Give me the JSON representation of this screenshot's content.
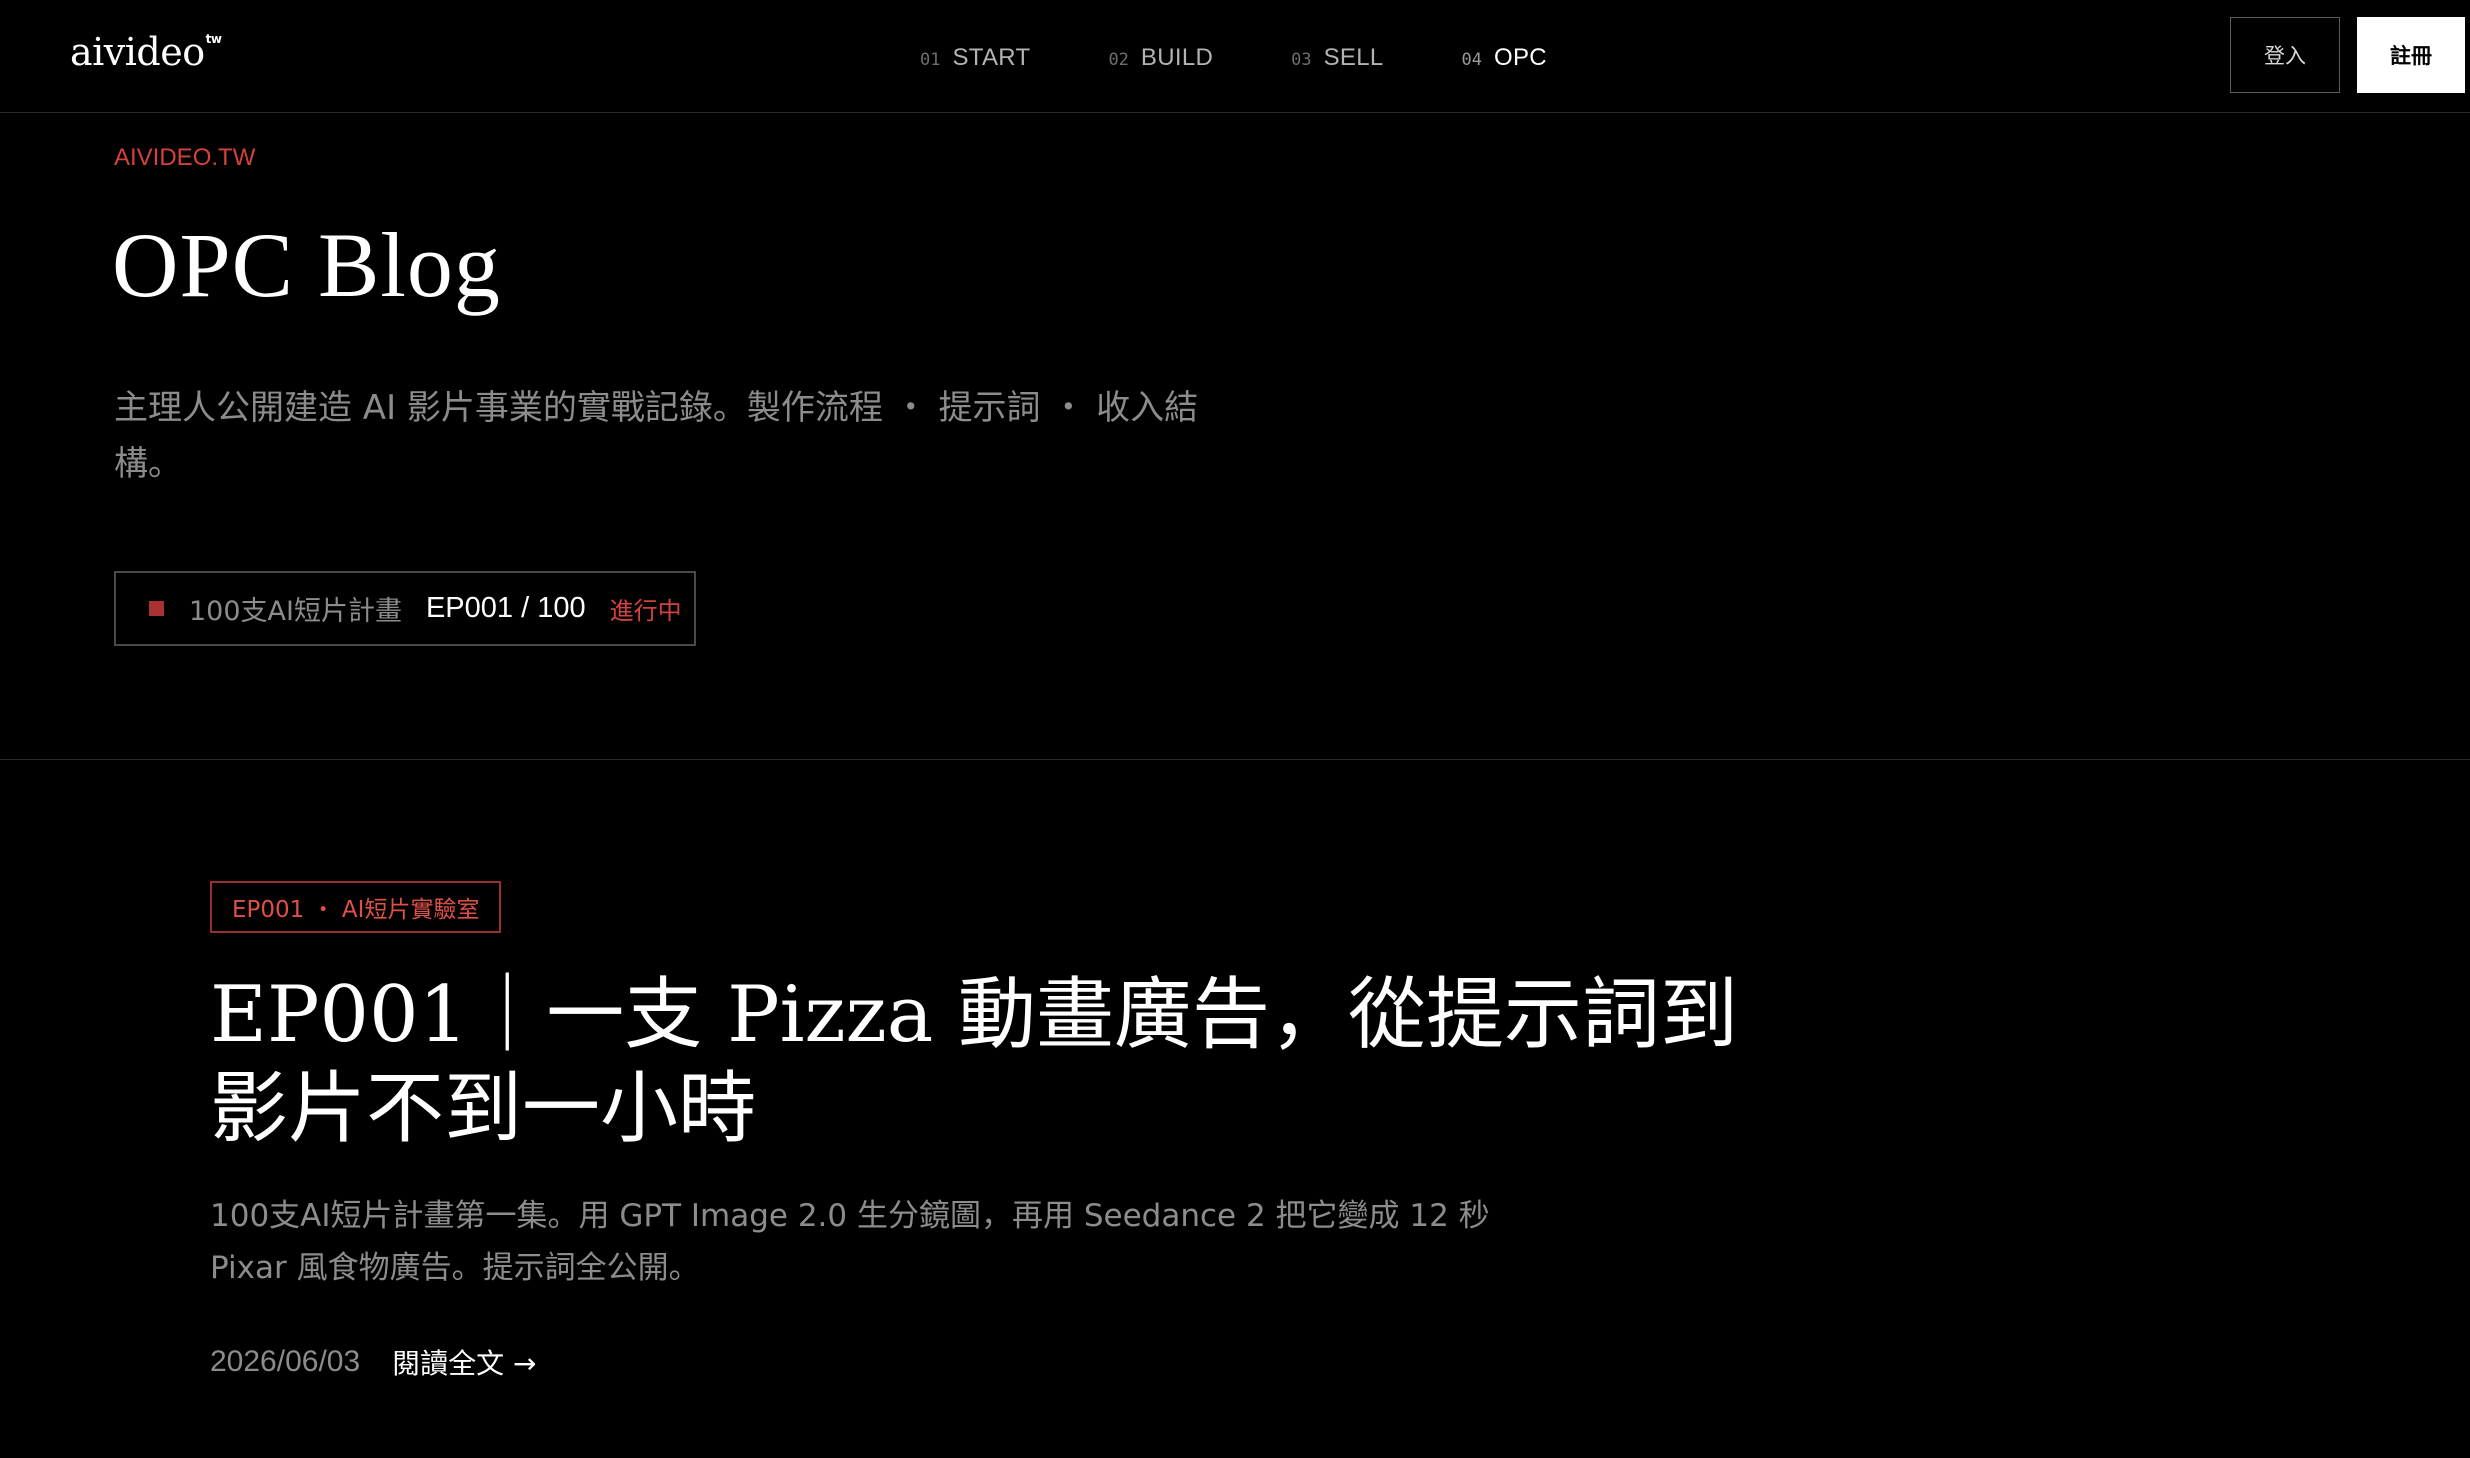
{
  "header": {
    "logo": "aivideo",
    "logo_sup": "tw",
    "nav": [
      {
        "num": "01",
        "label": "START"
      },
      {
        "num": "02",
        "label": "BUILD"
      },
      {
        "num": "03",
        "label": "SELL"
      },
      {
        "num": "04",
        "label": "OPC",
        "active": true
      }
    ],
    "login_label": "登入",
    "register_label": "註冊"
  },
  "hero": {
    "eyebrow": "AIVIDEO.TW",
    "title": "OPC Blog",
    "intro": "主理人公開建造 AI 影片事業的實戰記錄。製作流程 ・ 提示詞 ・ 收入結構。",
    "project": {
      "name": "100支AI短片計畫",
      "episode": "EP001 / 100",
      "status": "進行中"
    }
  },
  "post": {
    "tag": "EP001 ・ AI短片實驗室",
    "title": "EP001｜一支 Pizza 動畫廣告，從提示詞到影片不到一小時",
    "excerpt": "100支AI短片計畫第一集。用 GPT Image 2.0 生分鏡圖，再用 Seedance 2 把它變成 12 秒 Pixar 風食物廣告。提示詞全公開。",
    "date": "2026/06/03",
    "read_more": "閱讀全文 →"
  },
  "colors": {
    "background": "#000000",
    "accent_red": "#d4423e",
    "muted_text": "#8c8c8c",
    "divider": "#2a2a2a"
  }
}
